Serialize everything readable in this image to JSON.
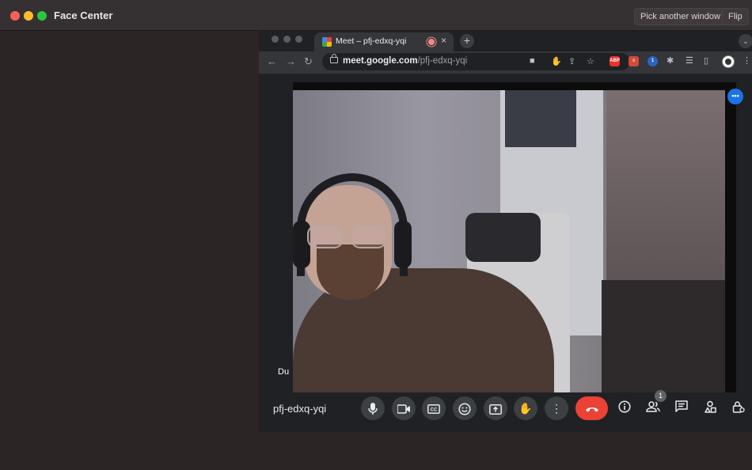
{
  "app": {
    "title": "Face Center",
    "pick_window_label": "Pick another window",
    "flip_label": "Flip"
  },
  "browser": {
    "tab": {
      "title": "Meet – pfj-edxq-yqi",
      "close": "×"
    },
    "new_tab": "+",
    "tab_menu": "⌄",
    "url": {
      "host": "meet.google.com",
      "path": "/pfj-edxq-yqi"
    },
    "nav": {
      "back": "←",
      "forward": "→",
      "reload": "↻"
    },
    "extensions": {
      "abp_label": "ABP"
    }
  },
  "meet": {
    "participant_name": "Du",
    "meeting_code": "pfj-edxq-yqi",
    "more_options_label": "•••",
    "people_count": "1"
  },
  "icons": {
    "mic": "microphone-icon",
    "camera": "video-camera-icon",
    "captions": "closed-captions-icon",
    "emoji": "emoji-icon",
    "present": "present-screen-icon",
    "raise_hand": "raise-hand-icon",
    "more": "more-vertical-icon",
    "end_call": "end-call-icon",
    "info": "info-icon",
    "people": "people-icon",
    "chat": "chat-icon",
    "activities": "activities-icon",
    "host_controls": "host-controls-icon"
  },
  "colors": {
    "end_call": "#ea4335",
    "meet_accent": "#1a73e8",
    "meet_bg": "#202124",
    "app_bg": "#2b2526"
  }
}
